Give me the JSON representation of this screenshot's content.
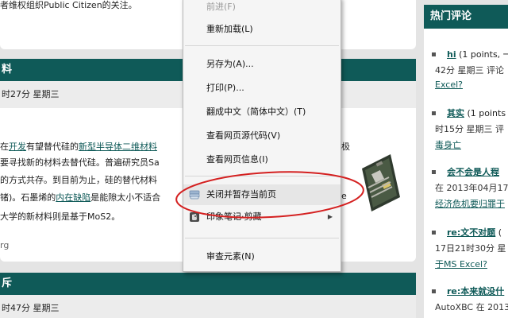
{
  "article1": {
    "tail_text": "者维权组织Public Citizen的关注。"
  },
  "article2": {
    "title_fragment": "料",
    "meta_fragment": "时27分 星期三",
    "p1_a": "在",
    "p1_link1": "开发",
    "p1_b": "有望替代硅的",
    "p1_link2": "新型半导体二维材料",
    "p1_tail": "极",
    "p2": "要寻找新的材料去替代硅。普遍研究员Sa",
    "p3": "的方式共存。到目前为止，硅的替代材料",
    "p4_a": "锗)。石墨烯的",
    "p4_link": "内在缺陷",
    "p4_b": "是能隙太小不适合",
    "p4_tail": "e",
    "p5": "大学的新材料则是基于MoS2。",
    "footer_fragment": "rg"
  },
  "article3": {
    "title_fragment": "斥",
    "meta_fragment": "时47分 星期三"
  },
  "sidebar": {
    "header": "热门评论",
    "items": [
      {
        "title": "hi",
        "line1_rest": " (1 points, 一",
        "line2": "42分 星期三 评论",
        "line3": "Excel?"
      },
      {
        "title": "其实",
        "line1_rest": " (1 points",
        "line2": "时15分 星期三 评",
        "line3": "毒身亡"
      },
      {
        "title": "会不会是人程",
        "line1_rest": "",
        "line2": "在 2013年04月17",
        "line3": "经济危机要归罪于"
      },
      {
        "title": "re:文不对题",
        "line1_rest": " (",
        "line2": "17日21时30分 星",
        "line3": "于MS Excel?"
      },
      {
        "title": "re:本来就没什",
        "line1_rest": "",
        "line2": "AutoXBC 在 2013",
        "line3": ""
      }
    ]
  },
  "context_menu": {
    "items": [
      {
        "label": "前进(F)",
        "disabled": true
      },
      {
        "label": "重新加载(L)"
      },
      {
        "label": "另存为(A)..."
      },
      {
        "label": "打印(P)..."
      },
      {
        "label": "翻成中文（简体中文）(T)"
      },
      {
        "label": "查看网页源代码(V)"
      },
      {
        "label": "查看网页信息(I)"
      },
      {
        "label": "关闭并暂存当前页",
        "icon": "stack-icon"
      },
      {
        "label": "印象笔记·剪藏",
        "icon": "evernote-icon",
        "submenu": true
      },
      {
        "label": "审查元素(N)"
      }
    ]
  },
  "colors": {
    "accent": "#0f5a58",
    "annotation": "#d42020"
  }
}
